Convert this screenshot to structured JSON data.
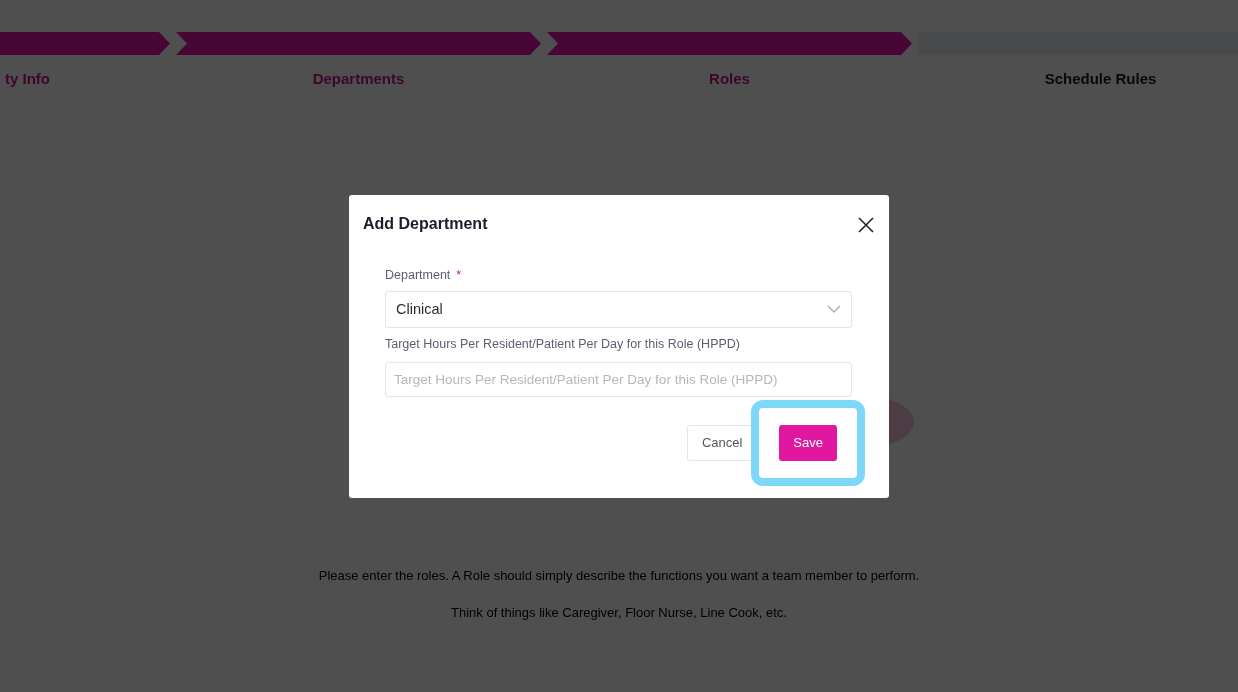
{
  "steps": [
    {
      "label": "ty Info",
      "completed": true
    },
    {
      "label": "Departments",
      "completed": true
    },
    {
      "label": "Roles",
      "completed": true
    },
    {
      "label": "Schedule Rules",
      "completed": false
    }
  ],
  "intro": {
    "lines": [
      "Please enter the roles. A Role should simply describe the functions you want a team member to perform.",
      "Think of things like Caregiver, Floor Nurse, Line Cook, etc."
    ]
  },
  "dialog": {
    "title": "Add Department",
    "department_field": {
      "label": "Department",
      "required": "*",
      "value": "Clinical"
    },
    "hppd_field": {
      "label": "Target Hours Per Resident/Patient Per Day for this Role (HPPD)",
      "placeholder": "Target Hours Per Resident/Patient Per Day for this Role (HPPD)"
    },
    "buttons": [
      {
        "label": "Cancel",
        "kind": "secondary",
        "highlighted": false
      },
      {
        "label": "Save",
        "kind": "primary",
        "highlighted": true
      }
    ]
  }
}
